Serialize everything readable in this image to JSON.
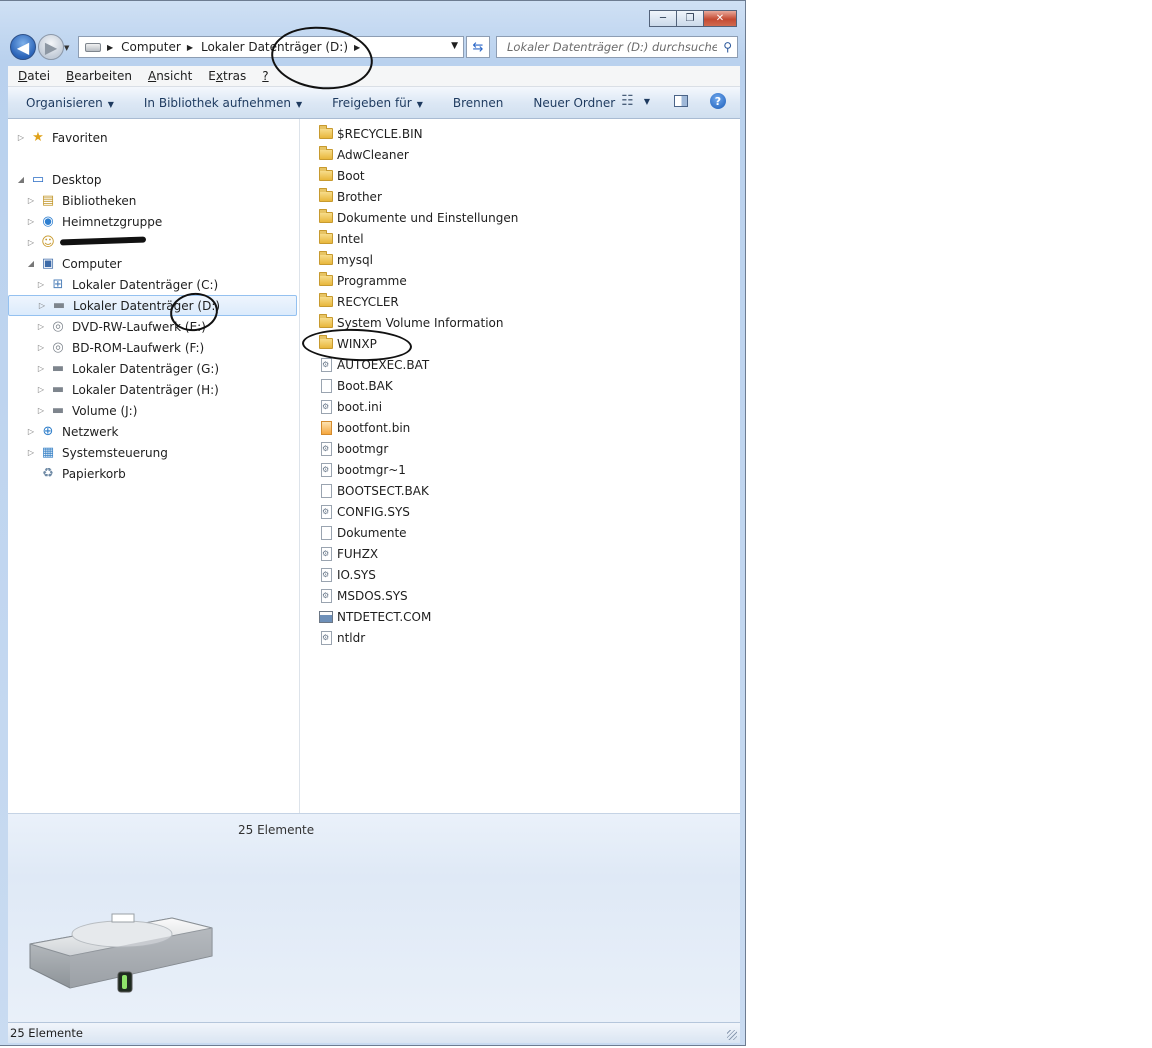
{
  "window": {
    "minimize": "─",
    "maximize": "❐",
    "close": "✕"
  },
  "navigation": {
    "back_glyph": "◀",
    "forward_glyph": "▶",
    "breadcrumbs": [
      "Computer",
      "Lokaler Datenträger (D:)"
    ],
    "search_placeholder": "Lokaler Datenträger (D:) durchsuchen"
  },
  "menu": [
    {
      "pre": "",
      "key": "D",
      "post": "atei"
    },
    {
      "pre": "",
      "key": "B",
      "post": "earbeiten"
    },
    {
      "pre": "",
      "key": "A",
      "post": "nsicht"
    },
    {
      "pre": "E",
      "key": "x",
      "post": "tras"
    },
    {
      "pre": "",
      "key": "?",
      "post": ""
    }
  ],
  "commands": {
    "organize": "Organisieren",
    "library": "In Bibliothek aufnehmen",
    "share": "Freigeben für",
    "burn": "Brennen",
    "new_folder": "Neuer Ordner",
    "help": "?"
  },
  "tree": [
    {
      "label": "Favoriten",
      "indent": 0,
      "twisty": "▷",
      "icon": "★",
      "icon_name": "favorites-star-icon",
      "color": "#e0a21a"
    },
    {
      "label": "",
      "indent": 0,
      "twisty": "",
      "icon": "",
      "icon_name": "",
      "color": "",
      "spacer": true
    },
    {
      "label": "Desktop",
      "indent": 0,
      "twisty": "◢",
      "icon": "▭",
      "icon_name": "desktop-icon",
      "color": "#2a6cc4"
    },
    {
      "label": "Bibliotheken",
      "indent": 1,
      "twisty": "▷",
      "icon": "▤",
      "icon_name": "libraries-icon",
      "color": "#c29628"
    },
    {
      "label": "Heimnetzgruppe",
      "indent": 1,
      "twisty": "▷",
      "icon": "◉",
      "icon_name": "homegroup-icon",
      "color": "#2f7fd0"
    },
    {
      "label": "",
      "indent": 1,
      "twisty": "▷",
      "icon": "☺",
      "icon_name": "user-folder-icon",
      "color": "#c89a2e",
      "redacted": true
    },
    {
      "label": "Computer",
      "indent": 1,
      "twisty": "◢",
      "icon": "▣",
      "icon_name": "computer-icon",
      "color": "#3c6aa8"
    },
    {
      "label": "Lokaler Datenträger (C:)",
      "indent": 2,
      "twisty": "▷",
      "icon": "⊞",
      "icon_name": "windows-drive-icon",
      "color": "#4e7fb8"
    },
    {
      "label": "Lokaler Datenträger (D:)",
      "indent": 2,
      "twisty": "▷",
      "icon": "▬",
      "icon_name": "hard-drive-icon",
      "color": "#7e858d",
      "selected": true
    },
    {
      "label": "DVD-RW-Laufwerk (E:)",
      "indent": 2,
      "twisty": "▷",
      "icon": "◎",
      "icon_name": "dvd-drive-icon",
      "color": "#7e858d"
    },
    {
      "label": "BD-ROM-Laufwerk (F:)",
      "indent": 2,
      "twisty": "▷",
      "icon": "◎",
      "icon_name": "bd-drive-icon",
      "color": "#7e858d"
    },
    {
      "label": "Lokaler Datenträger (G:)",
      "indent": 2,
      "twisty": "▷",
      "icon": "▬",
      "icon_name": "hard-drive-icon",
      "color": "#7e858d"
    },
    {
      "label": "Lokaler Datenträger (H:)",
      "indent": 2,
      "twisty": "▷",
      "icon": "▬",
      "icon_name": "hard-drive-icon",
      "color": "#7e858d"
    },
    {
      "label": "Volume (J:)",
      "indent": 2,
      "twisty": "▷",
      "icon": "▬",
      "icon_name": "hard-drive-icon",
      "color": "#7e858d"
    },
    {
      "label": "Netzwerk",
      "indent": 1,
      "twisty": "▷",
      "icon": "⊕",
      "icon_name": "network-icon",
      "color": "#2a7bc9"
    },
    {
      "label": "Systemsteuerung",
      "indent": 1,
      "twisty": "▷",
      "icon": "▦",
      "icon_name": "control-panel-icon",
      "color": "#3a83c7"
    },
    {
      "label": "Papierkorb",
      "indent": 1,
      "twisty": "",
      "icon": "♻",
      "icon_name": "recycle-bin-icon",
      "color": "#6f8aa5"
    }
  ],
  "files": [
    {
      "name": "$RECYCLE.BIN",
      "type": "folder"
    },
    {
      "name": "AdwCleaner",
      "type": "folder"
    },
    {
      "name": "Boot",
      "type": "folder"
    },
    {
      "name": "Brother",
      "type": "folder"
    },
    {
      "name": "Dokumente und Einstellungen",
      "type": "folder"
    },
    {
      "name": "Intel",
      "type": "folder"
    },
    {
      "name": "mysql",
      "type": "folder"
    },
    {
      "name": "Programme",
      "type": "folder"
    },
    {
      "name": "RECYCLER",
      "type": "folder"
    },
    {
      "name": "System Volume Information",
      "type": "folder"
    },
    {
      "name": "WINXP",
      "type": "folder"
    },
    {
      "name": "AUTOEXEC.BAT",
      "type": "sys"
    },
    {
      "name": "Boot.BAK",
      "type": "doc"
    },
    {
      "name": "boot.ini",
      "type": "sys"
    },
    {
      "name": "bootfont.bin",
      "type": "bin"
    },
    {
      "name": "bootmgr",
      "type": "sys"
    },
    {
      "name": "bootmgr~1",
      "type": "sys"
    },
    {
      "name": "BOOTSECT.BAK",
      "type": "doc"
    },
    {
      "name": "CONFIG.SYS",
      "type": "sys"
    },
    {
      "name": "Dokumente",
      "type": "doc"
    },
    {
      "name": "FUHZX",
      "type": "sys"
    },
    {
      "name": "IO.SYS",
      "type": "sys"
    },
    {
      "name": "MSDOS.SYS",
      "type": "sys"
    },
    {
      "name": "NTDETECT.COM",
      "type": "com"
    },
    {
      "name": "ntldr",
      "type": "sys"
    }
  ],
  "details": {
    "count": "25 Elemente"
  },
  "status": {
    "count": "25 Elemente"
  }
}
